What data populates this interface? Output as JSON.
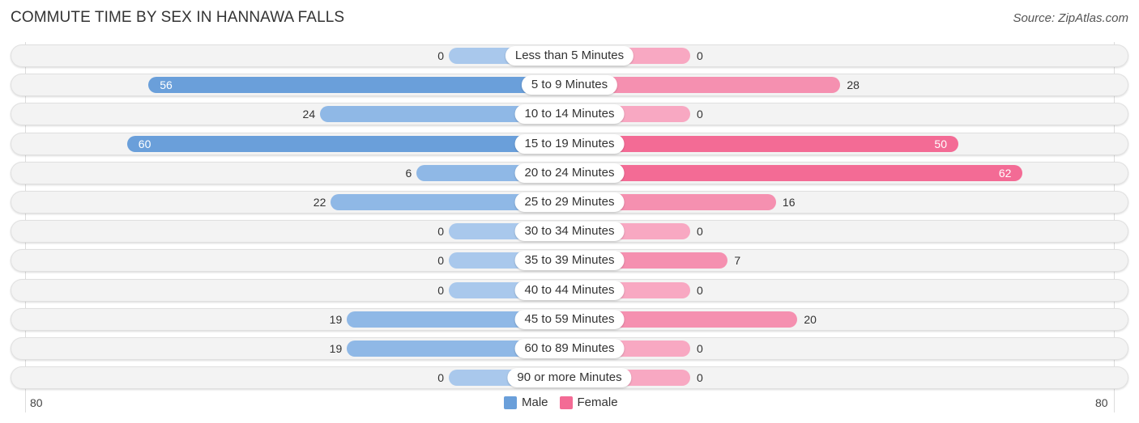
{
  "chart_data": {
    "type": "bar",
    "orientation": "horizontal-diverging",
    "title": "COMMUTE TIME BY SEX IN HANNAWA FALLS",
    "source": "Source: ZipAtlas.com",
    "categories": [
      "Less than 5 Minutes",
      "5 to 9 Minutes",
      "10 to 14 Minutes",
      "15 to 19 Minutes",
      "20 to 24 Minutes",
      "25 to 29 Minutes",
      "30 to 34 Minutes",
      "35 to 39 Minutes",
      "40 to 44 Minutes",
      "45 to 59 Minutes",
      "60 to 89 Minutes",
      "90 or more Minutes"
    ],
    "series": [
      {
        "name": "Male",
        "color": "#6a9fda",
        "values": [
          0,
          56,
          24,
          60,
          6,
          22,
          0,
          0,
          0,
          19,
          19,
          0
        ]
      },
      {
        "name": "Female",
        "color": "#f36b95",
        "values": [
          0,
          28,
          0,
          50,
          62,
          16,
          0,
          7,
          0,
          20,
          0,
          0
        ]
      }
    ],
    "axis": {
      "left_tick": "80",
      "right_tick": "80",
      "max": 80
    },
    "legend": {
      "position": "bottom-center",
      "items": [
        "Male",
        "Female"
      ]
    }
  }
}
